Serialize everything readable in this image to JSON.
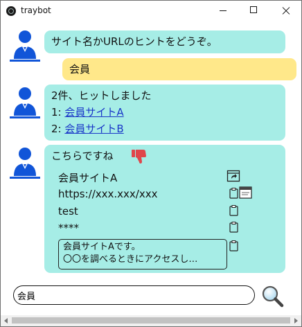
{
  "window": {
    "title": "traybot"
  },
  "messages": {
    "greeting": "サイト名かURLのヒントをどうぞ。",
    "user_query": "会員",
    "result_count": "2件、ヒットしました",
    "results": [
      {
        "index": "1:",
        "label": "会員サイトA"
      },
      {
        "index": "2:",
        "label": "会員サイトB"
      }
    ],
    "detail_header": "こちらですね",
    "detail": {
      "name": "会員サイトA",
      "url": "https://xxx.xxx/xxx",
      "user": "test",
      "password": "****",
      "memo_line1": "会員サイトAです。",
      "memo_line2": "〇〇を調べるときにアクセスし…"
    }
  },
  "input": {
    "value": "会員"
  },
  "colors": {
    "bot_bubble": "#a6ede6",
    "user_bubble": "#ffe88a",
    "avatar": "#1155d8",
    "thumbs_down": "#e0464b"
  },
  "icons": {
    "avatar": "bot-avatar-icon",
    "thumbs_down": "thumbs-down-icon",
    "search": "magnifier-icon",
    "copy": "clipboard-icon",
    "open": "open-external-icon",
    "browser": "browser-icon"
  }
}
